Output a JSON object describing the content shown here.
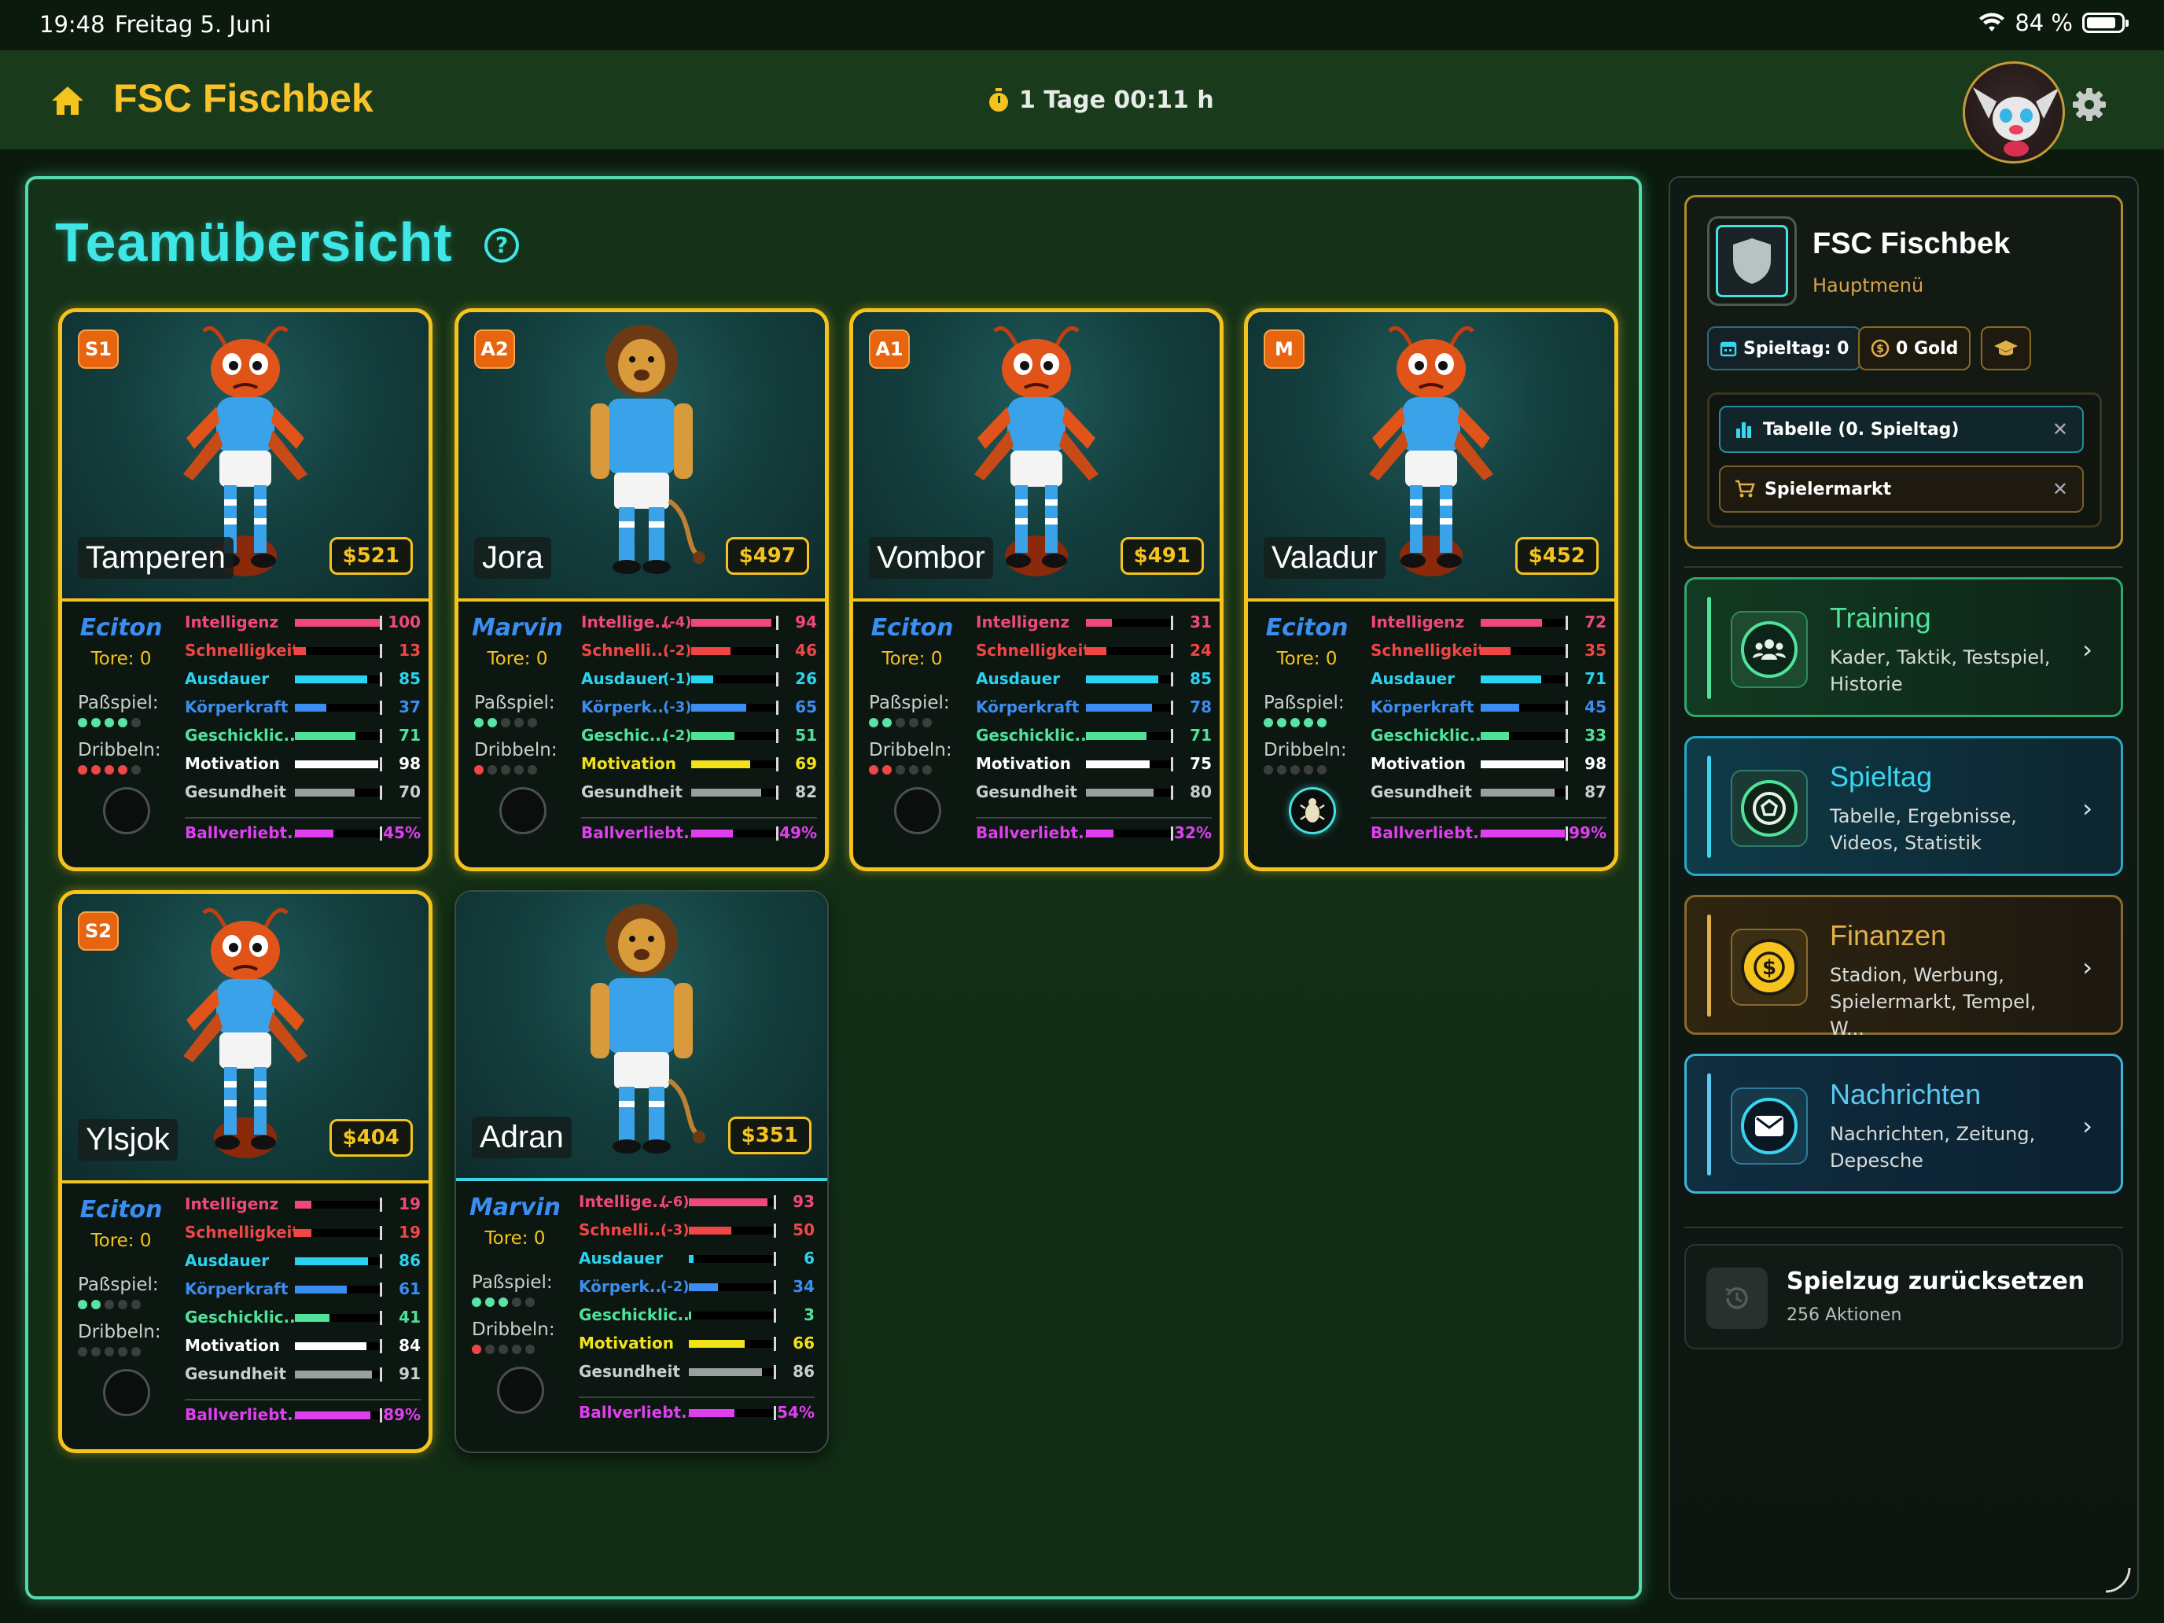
{
  "status_bar": {
    "time": "19:48",
    "date": "Freitag 5. Juni",
    "battery": "84 %"
  },
  "header": {
    "club_name": "FSC Fischbek",
    "timer": "1 Tage 00:11 h"
  },
  "main": {
    "title": "Teamübersicht"
  },
  "colors": {
    "accent": "#3ee6e6",
    "gold": "#f5c31d",
    "intelligenz": "#f0487a",
    "schnelligkeit": "#f04646",
    "ausdauer": "#2ad3ef",
    "koerperkraft": "#3b8df0",
    "geschick": "#4fe39a",
    "motivation": "#ffffff",
    "gesundheit": "#9aa0a0",
    "ballverliebt": "#e03ff0"
  },
  "players": [
    {
      "position": "S1",
      "name": "Tamperen",
      "price": "$521",
      "trainer": "Eciton",
      "goals": "Tore: 0",
      "species": "ant",
      "pass": 4,
      "dribble": 4,
      "slot_active": false,
      "pass_label": "Paßspiel:",
      "dribble_label": "Dribbeln:",
      "stats": [
        {
          "label": "Intelligenz",
          "mod": "",
          "value": "100",
          "level": 100,
          "color": "#f0487a"
        },
        {
          "label": "Schnelligkeit",
          "mod": "",
          "value": "13",
          "level": 13,
          "color": "#f04646"
        },
        {
          "label": "Ausdauer",
          "mod": "",
          "value": "85",
          "level": 85,
          "color": "#2ad3ef"
        },
        {
          "label": "Körperkraft",
          "mod": "",
          "value": "37",
          "level": 37,
          "color": "#3b8df0"
        },
        {
          "label": "Geschicklic...",
          "mod": "",
          "value": "71",
          "level": 71,
          "color": "#4fe39a"
        },
        {
          "label": "Motivation",
          "mod": "",
          "value": "98",
          "level": 98,
          "color": "#ffffff"
        },
        {
          "label": "Gesundheit",
          "mod": "",
          "value": "70",
          "level": 70,
          "color": "#9aa0a0"
        },
        {
          "label": "Ballverliebt...",
          "mod": "",
          "value": "45%",
          "level": 45,
          "color": "#e03ff0"
        }
      ]
    },
    {
      "position": "A2",
      "name": "Jora",
      "price": "$497",
      "trainer": "Marvin",
      "goals": "Tore: 0",
      "species": "lion",
      "pass": 2,
      "dribble": 1,
      "slot_active": false,
      "pass_label": "Paßspiel:",
      "dribble_label": "Dribbeln:",
      "stats": [
        {
          "label": "Intellige...",
          "mod": "(-4)",
          "value": "94",
          "level": 94,
          "color": "#f0487a"
        },
        {
          "label": "Schnelli...",
          "mod": "(-2)",
          "value": "46",
          "level": 46,
          "color": "#f04646"
        },
        {
          "label": "Ausdauer",
          "mod": "(-1)",
          "value": "26",
          "level": 26,
          "color": "#2ad3ef"
        },
        {
          "label": "Körperk...",
          "mod": "(-3)",
          "value": "65",
          "level": 65,
          "color": "#3b8df0"
        },
        {
          "label": "Geschic...",
          "mod": "(-2)",
          "value": "51",
          "level": 51,
          "color": "#4fe39a"
        },
        {
          "label": "Motivation",
          "mod": "",
          "value": "69",
          "level": 69,
          "color": "#f2e21a"
        },
        {
          "label": "Gesundheit",
          "mod": "",
          "value": "82",
          "level": 82,
          "color": "#9aa0a0"
        },
        {
          "label": "Ballverliebt...",
          "mod": "",
          "value": "49%",
          "level": 49,
          "color": "#e03ff0"
        }
      ]
    },
    {
      "position": "A1",
      "name": "Vombor",
      "price": "$491",
      "trainer": "Eciton",
      "goals": "Tore: 0",
      "species": "ant",
      "pass": 2,
      "dribble": 2,
      "slot_active": false,
      "pass_label": "Paßspiel:",
      "dribble_label": "Dribbeln:",
      "stats": [
        {
          "label": "Intelligenz",
          "mod": "",
          "value": "31",
          "level": 31,
          "color": "#f0487a"
        },
        {
          "label": "Schnelligkeit",
          "mod": "",
          "value": "24",
          "level": 24,
          "color": "#f04646"
        },
        {
          "label": "Ausdauer",
          "mod": "",
          "value": "85",
          "level": 85,
          "color": "#2ad3ef"
        },
        {
          "label": "Körperkraft",
          "mod": "",
          "value": "78",
          "level": 78,
          "color": "#3b8df0"
        },
        {
          "label": "Geschicklic...",
          "mod": "",
          "value": "71",
          "level": 71,
          "color": "#4fe39a"
        },
        {
          "label": "Motivation",
          "mod": "",
          "value": "75",
          "level": 75,
          "color": "#ffffff"
        },
        {
          "label": "Gesundheit",
          "mod": "",
          "value": "80",
          "level": 80,
          "color": "#9aa0a0"
        },
        {
          "label": "Ballverliebt...",
          "mod": "",
          "value": "32%",
          "level": 32,
          "color": "#e03ff0"
        }
      ]
    },
    {
      "position": "M",
      "name": "Valadur",
      "price": "$452",
      "trainer": "Eciton",
      "goals": "Tore: 0",
      "species": "ant",
      "pass": 5,
      "dribble": 0,
      "slot_active": true,
      "pass_label": "Paßspiel:",
      "dribble_label": "Dribbeln:",
      "stats": [
        {
          "label": "Intelligenz",
          "mod": "",
          "value": "72",
          "level": 72,
          "color": "#f0487a"
        },
        {
          "label": "Schnelligkeit",
          "mod": "",
          "value": "35",
          "level": 35,
          "color": "#f04646"
        },
        {
          "label": "Ausdauer",
          "mod": "",
          "value": "71",
          "level": 71,
          "color": "#2ad3ef"
        },
        {
          "label": "Körperkraft",
          "mod": "",
          "value": "45",
          "level": 45,
          "color": "#3b8df0"
        },
        {
          "label": "Geschicklic...",
          "mod": "",
          "value": "33",
          "level": 33,
          "color": "#4fe39a"
        },
        {
          "label": "Motivation",
          "mod": "",
          "value": "98",
          "level": 98,
          "color": "#ffffff"
        },
        {
          "label": "Gesundheit",
          "mod": "",
          "value": "87",
          "level": 87,
          "color": "#9aa0a0"
        },
        {
          "label": "Ballverliebt...",
          "mod": "",
          "value": "99%",
          "level": 99,
          "color": "#e03ff0"
        }
      ]
    },
    {
      "position": "S2",
      "name": "Ylsjok",
      "price": "$404",
      "trainer": "Eciton",
      "goals": "Tore: 0",
      "species": "ant",
      "pass": 2,
      "dribble": 0,
      "slot_active": false,
      "pass_label": "Paßspiel:",
      "dribble_label": "Dribbeln:",
      "stats": [
        {
          "label": "Intelligenz",
          "mod": "",
          "value": "19",
          "level": 19,
          "color": "#f0487a"
        },
        {
          "label": "Schnelligkeit",
          "mod": "",
          "value": "19",
          "level": 19,
          "color": "#f04646"
        },
        {
          "label": "Ausdauer",
          "mod": "",
          "value": "86",
          "level": 86,
          "color": "#2ad3ef"
        },
        {
          "label": "Körperkraft",
          "mod": "",
          "value": "61",
          "level": 61,
          "color": "#3b8df0"
        },
        {
          "label": "Geschicklic...",
          "mod": "",
          "value": "41",
          "level": 41,
          "color": "#4fe39a"
        },
        {
          "label": "Motivation",
          "mod": "",
          "value": "84",
          "level": 84,
          "color": "#ffffff"
        },
        {
          "label": "Gesundheit",
          "mod": "",
          "value": "91",
          "level": 91,
          "color": "#9aa0a0"
        },
        {
          "label": "Ballverliebt...",
          "mod": "",
          "value": "89%",
          "level": 89,
          "color": "#e03ff0"
        }
      ]
    },
    {
      "position": "",
      "name": "Adran",
      "price": "$351",
      "trainer": "Marvin",
      "goals": "Tore: 0",
      "species": "lion",
      "pass": 3,
      "dribble": 1,
      "slot_active": false,
      "pass_label": "Paßspiel:",
      "dribble_label": "Dribbeln:",
      "stats": [
        {
          "label": "Intellige...",
          "mod": "(-6)",
          "value": "93",
          "level": 93,
          "color": "#f0487a"
        },
        {
          "label": "Schnelli...",
          "mod": "(-3)",
          "value": "50",
          "level": 50,
          "color": "#f04646"
        },
        {
          "label": "Ausdauer",
          "mod": "",
          "value": "6",
          "level": 6,
          "color": "#2ad3ef"
        },
        {
          "label": "Körperk...",
          "mod": "(-2)",
          "value": "34",
          "level": 34,
          "color": "#3b8df0"
        },
        {
          "label": "Geschicklic...",
          "mod": "",
          "value": "3",
          "level": 3,
          "color": "#4fe39a"
        },
        {
          "label": "Motivation",
          "mod": "",
          "value": "66",
          "level": 66,
          "color": "#f2e21a"
        },
        {
          "label": "Gesundheit",
          "mod": "",
          "value": "86",
          "level": 86,
          "color": "#9aa0a0"
        },
        {
          "label": "Ballverliebt...",
          "mod": "",
          "value": "54%",
          "level": 54,
          "color": "#e03ff0"
        }
      ]
    }
  ],
  "sidebar": {
    "club_name": "FSC Fischbek",
    "club_sub": "Hauptmenü",
    "chip_day": "Spieltag: 0",
    "chip_gold": "0 Gold",
    "tabs": [
      {
        "label": "Tabelle (0. Spieltag)",
        "icon": "bar-chart-icon"
      },
      {
        "label": "Spielermarkt",
        "icon": "cart-icon"
      }
    ],
    "menu": [
      {
        "title": "Training",
        "desc": "Kader, Taktik, Testspiel, Historie",
        "color": "#4fe39a"
      },
      {
        "title": "Spieltag",
        "desc": "Tabelle, Ergebnisse, Videos, Statistik",
        "color": "#3ad5f0"
      },
      {
        "title": "Finanzen",
        "desc": "Stadion, Werbung, Spielermarkt, Tempel, W...",
        "color": "#e0b04a"
      },
      {
        "title": "Nachrichten",
        "desc": "Nachrichten, Zeitung, Depesche",
        "color": "#5cc8f0"
      }
    ],
    "reset": {
      "title": "Spielzug zurücksetzen",
      "sub": "256 Aktionen"
    }
  }
}
